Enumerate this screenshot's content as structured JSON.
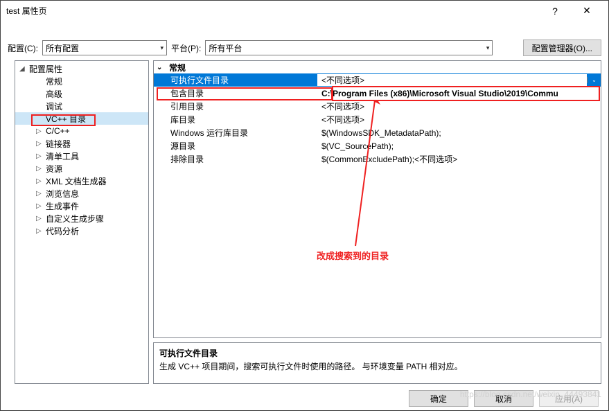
{
  "window": {
    "title": "test 属性页",
    "help_icon": "?",
    "close_icon": "✕"
  },
  "toolbar": {
    "config_label": "配置(C):",
    "config_value": "所有配置",
    "platform_label": "平台(P):",
    "platform_value": "所有平台",
    "manager_button": "配置管理器(O)..."
  },
  "tree": {
    "root": "配置属性",
    "items": [
      {
        "label": "常规"
      },
      {
        "label": "高级"
      },
      {
        "label": "调试"
      },
      {
        "label": "VC++ 目录",
        "selected": true
      },
      {
        "label": "C/C++",
        "expandable": true
      },
      {
        "label": "链接器",
        "expandable": true
      },
      {
        "label": "清单工具",
        "expandable": true
      },
      {
        "label": "资源",
        "expandable": true
      },
      {
        "label": "XML 文档生成器",
        "expandable": true
      },
      {
        "label": "浏览信息",
        "expandable": true
      },
      {
        "label": "生成事件",
        "expandable": true
      },
      {
        "label": "自定义生成步骤",
        "expandable": true
      },
      {
        "label": "代码分析",
        "expandable": true
      }
    ]
  },
  "grid": {
    "section": "常规",
    "rows": [
      {
        "label": "可执行文件目录",
        "value": "<不同选项>",
        "highlighted": true,
        "dropdown": true
      },
      {
        "label": "包含目录",
        "value": "C:\\Program Files (x86)\\Microsoft Visual Studio\\2019\\Commu",
        "bold": true
      },
      {
        "label": "引用目录",
        "value": "<不同选项>"
      },
      {
        "label": "库目录",
        "value": "<不同选项>"
      },
      {
        "label": "Windows 运行库目录",
        "value": "$(WindowsSDK_MetadataPath);"
      },
      {
        "label": "源目录",
        "value": "$(VC_SourcePath);"
      },
      {
        "label": "排除目录",
        "value": "$(CommonExcludePath);<不同选项>"
      }
    ]
  },
  "description": {
    "title": "可执行文件目录",
    "text": "生成 VC++ 项目期间，搜索可执行文件时使用的路径。  与环境变量 PATH 相对应。"
  },
  "footer": {
    "ok": "确定",
    "cancel": "取消",
    "apply": "应用(A)"
  },
  "annotation": {
    "text": "改成搜索到的目录"
  },
  "watermark": "https://blog.csdn.net/weixin_44493841"
}
